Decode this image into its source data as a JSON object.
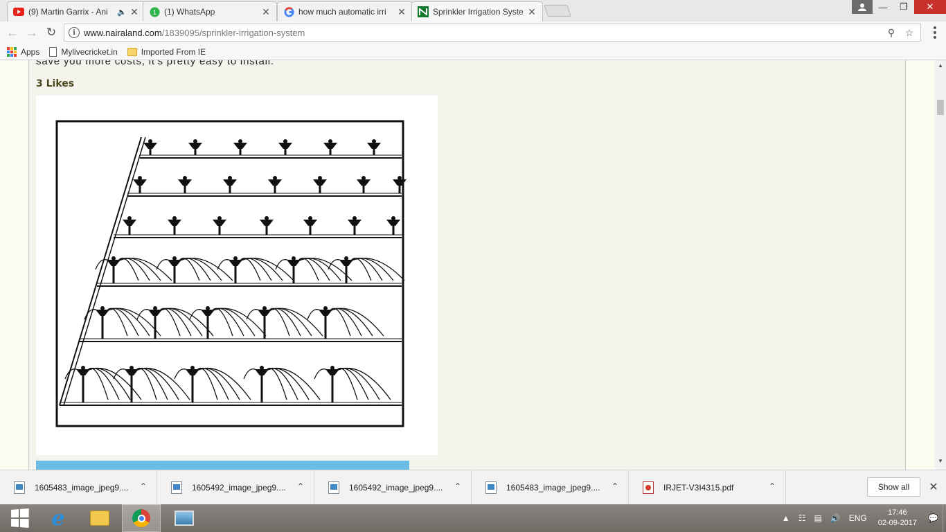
{
  "tabs": [
    {
      "title": "(9) Martin Garrix - Ani",
      "favicon": "youtube-icon",
      "extra": "speaker-icon"
    },
    {
      "title": "(1) WhatsApp",
      "favicon": "whatsapp-icon"
    },
    {
      "title": "how much automatic irri",
      "favicon": "google-icon"
    },
    {
      "title": "Sprinkler Irrigation Syste",
      "favicon": "nairaland-icon"
    }
  ],
  "toolbar": {
    "url_host": "www.nairaland.com",
    "url_path": "/1839095/sprinkler-irrigation-system"
  },
  "bookmarks": [
    {
      "label": "Apps",
      "icon": "apps-grid-icon"
    },
    {
      "label": "Mylivecricket.in",
      "icon": "page-icon"
    },
    {
      "label": "Imported From IE",
      "icon": "folder-icon"
    }
  ],
  "post": {
    "text": "save you more costs, it's pretty easy to install.",
    "likes": "3 Likes",
    "image_subject": "sprinkler-irrigation-diagram"
  },
  "downloads": [
    {
      "name": "1605483_image_jpeg9....",
      "icon": "image-file-icon"
    },
    {
      "name": "1605492_image_jpeg9....",
      "icon": "image-file-icon"
    },
    {
      "name": "1605492_image_jpeg9....",
      "icon": "image-file-icon"
    },
    {
      "name": "1605483_image_jpeg9....",
      "icon": "image-file-icon"
    },
    {
      "name": "IRJET-V3I4315.pdf",
      "icon": "pdf-file-icon"
    }
  ],
  "shelf": {
    "show_all": "Show all"
  },
  "tray": {
    "lang": "ENG",
    "time": "17:46",
    "date": "02-09-2017"
  },
  "colors": {
    "accent_blue": "#6bbde6",
    "likes_text": "#4a4a1e",
    "close_red": "#c7312a"
  }
}
